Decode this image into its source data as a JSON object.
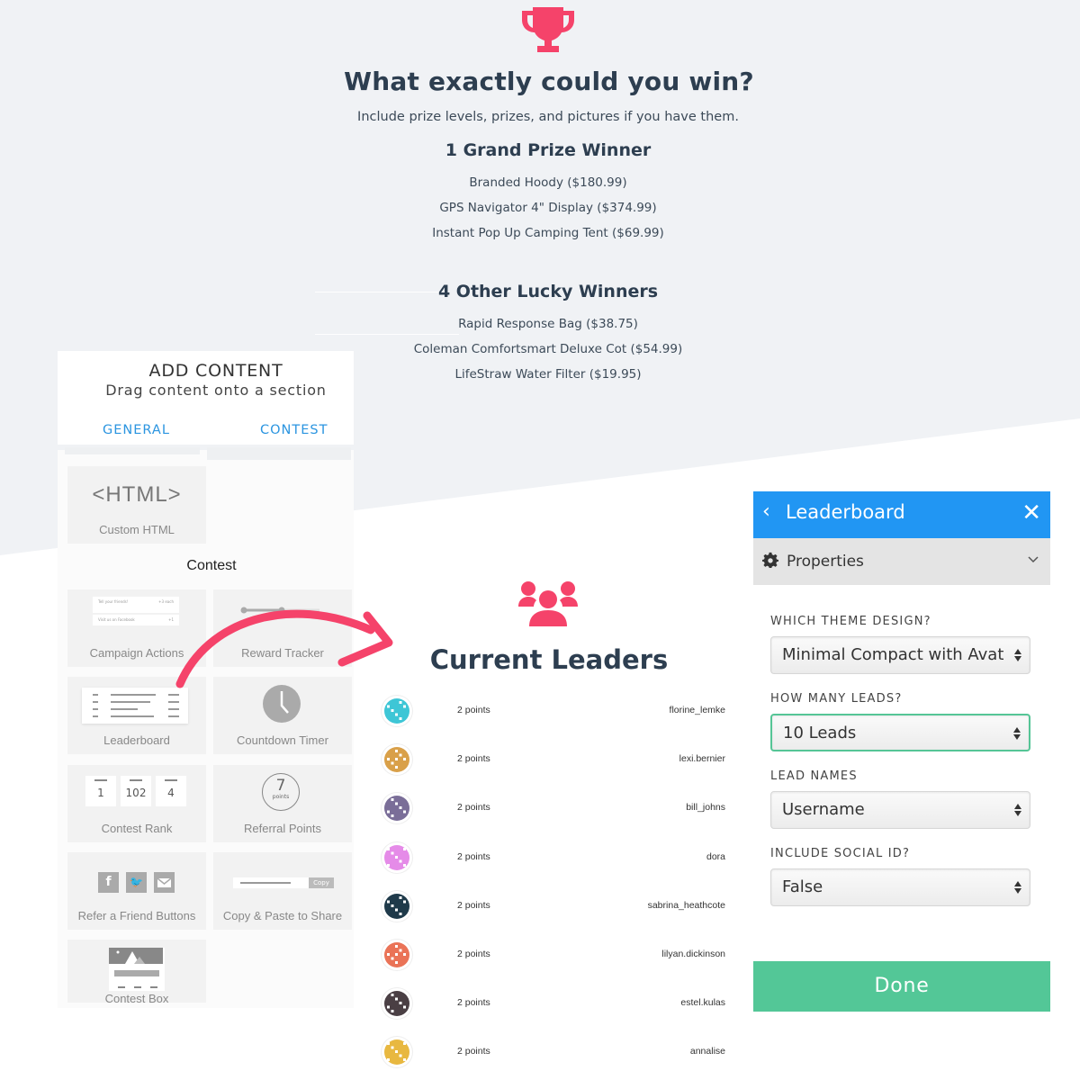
{
  "colors": {
    "accent_pink": "#f5436a",
    "heading": "#2d3e50",
    "blue": "#2196f3",
    "tab_blue": "#2b95e0",
    "green": "#53c797",
    "bg_gray": "#f0f2f5"
  },
  "prizes": {
    "icon": "trophy-icon",
    "title": "What exactly could you win?",
    "subtitle": "Include prize levels, prizes, and pictures if you have them.",
    "levels": [
      {
        "heading": "1 Grand Prize Winner",
        "items": [
          "Branded Hoody ($180.99)",
          "GPS Navigator 4\" Display ($374.99)",
          "Instant Pop Up Camping Tent ($69.99)"
        ]
      },
      {
        "heading": "4 Other Lucky Winners",
        "items": [
          "Rapid Response Bag ($38.75)",
          "Coleman Comfortsmart Deluxe Cot ($54.99)",
          "LifeStraw Water Filter ($19.95)"
        ]
      }
    ]
  },
  "add_content": {
    "title": "ADD CONTENT",
    "subtitle": "Drag content onto a section",
    "tabs": [
      "GENERAL",
      "CONTEST"
    ],
    "general_tiles": [
      {
        "icon_text": "<HTML>",
        "label": "Custom HTML"
      }
    ],
    "section_label": "Contest",
    "contest_tiles": [
      {
        "label": "Campaign Actions",
        "preview": [
          "Tell your friends!",
          "+3 each",
          "Visit us on Facebook",
          "+1"
        ]
      },
      {
        "label": "Reward Tracker"
      },
      {
        "label": "Leaderboard"
      },
      {
        "label": "Countdown Timer"
      },
      {
        "label": "Contest Rank",
        "ranks": [
          "1",
          "102",
          "4"
        ]
      },
      {
        "label": "Referral Points",
        "points_value": "7",
        "points_unit": "points"
      },
      {
        "label": "Refer a Friend Buttons"
      },
      {
        "label": "Copy & Paste to Share",
        "copy_label": "Copy"
      },
      {
        "label": "Contest Box"
      }
    ]
  },
  "leaders": {
    "icon": "users-icon",
    "title": "Current Leaders",
    "rows": [
      {
        "points": "2 points",
        "name": "florine_lemke",
        "avatar_color": "#3ec6d6"
      },
      {
        "points": "2 points",
        "name": "lexi.bernier",
        "avatar_color": "#d9a049"
      },
      {
        "points": "2 points",
        "name": "bill_johns",
        "avatar_color": "#7a6e98"
      },
      {
        "points": "2 points",
        "name": "dora",
        "avatar_color": "#e58be8"
      },
      {
        "points": "2 points",
        "name": "sabrina_heathcote",
        "avatar_color": "#1f3a4a"
      },
      {
        "points": "2 points",
        "name": "lilyan.dickinson",
        "avatar_color": "#ea7357"
      },
      {
        "points": "2 points",
        "name": "estel.kulas",
        "avatar_color": "#4a3f44"
      },
      {
        "points": "2 points",
        "name": "annalise",
        "avatar_color": "#e8b840"
      }
    ]
  },
  "properties_panel": {
    "title": "Leaderboard",
    "section": "Properties",
    "fields": [
      {
        "label": "WHICH THEME DESIGN?",
        "value": "Minimal Compact with Avat"
      },
      {
        "label": "HOW MANY LEADS?",
        "value": "10 Leads"
      },
      {
        "label": "LEAD NAMES",
        "value": "Username"
      },
      {
        "label": "INCLUDE SOCIAL ID?",
        "value": "False"
      }
    ],
    "done_label": "Done"
  }
}
